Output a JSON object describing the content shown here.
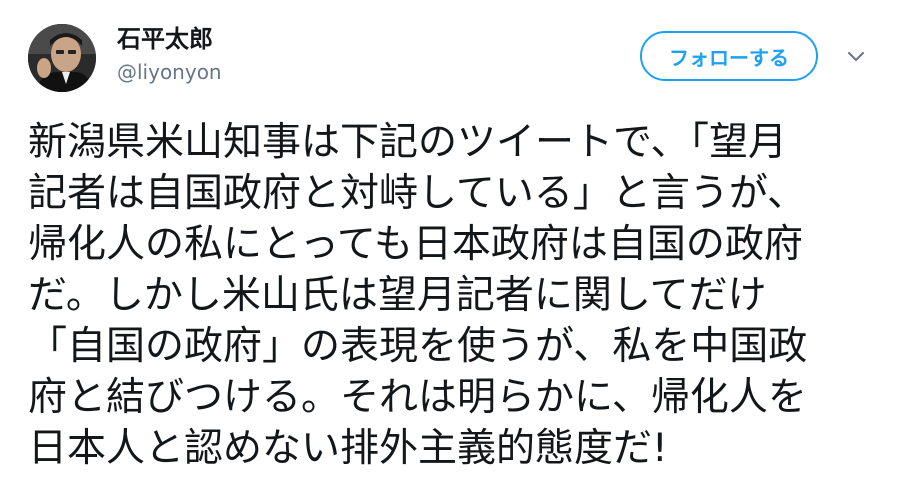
{
  "user": {
    "display_name": "石平太郎",
    "handle": "@liyonyon",
    "avatar_icon": "profile-photo"
  },
  "actions": {
    "follow_label": "フォローする",
    "menu_icon": "chevron-down-icon"
  },
  "tweet": {
    "lines": [
      "新潟県米山知事は下記のツイートで、「望月",
      "記者は自国政府と対峙している」と言うが、",
      "帰化人の私にとっても日本政府は自国の政府",
      "だ。しかし米山氏は望月記者に関してだけ",
      "「自国の政府」の表現を使うが、私を中国政",
      "府と結びつける。それは明らかに、帰化人を",
      "日本人と認めない排外主義的態度だ!"
    ]
  },
  "colors": {
    "accent": "#1da1f2",
    "text": "#14171a",
    "muted": "#657786"
  }
}
